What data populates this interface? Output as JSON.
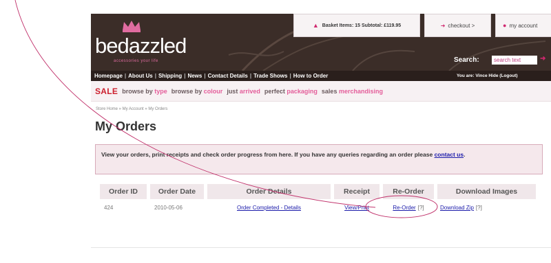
{
  "header": {
    "logo_text": "bedazzled",
    "logo_tagline": "accessories your life",
    "basket": "Basket Items: 15 Subtotal: £119.95",
    "checkout": "checkout >",
    "my_account": "my account",
    "search_label": "Search:",
    "search_value": "search text",
    "user_info": "You are: Vince Hide (Logout)"
  },
  "nav": {
    "items": [
      "Homepage",
      "About Us",
      "Shipping",
      "News",
      "Contact Details",
      "Trade Shows",
      "How to Order"
    ]
  },
  "catbar": {
    "sale": "SALE",
    "browse_type_prefix": "browse by",
    "browse_type_word": "type",
    "browse_colour_prefix": "browse by",
    "browse_colour_word": "colour",
    "arrived_prefix": "just",
    "arrived_word": "arrived",
    "packaging_prefix": "perfect",
    "packaging_word": "packaging",
    "merch_prefix": "sales",
    "merch_word": "merchandising"
  },
  "breadcrumb": "Store Home » My Account » My Orders",
  "page_title": "My Orders",
  "info": {
    "text": "View your orders, print receipts and check order progress from here. If you have any queries regarding an order please",
    "link": "contact us",
    "end": "."
  },
  "table": {
    "headers": [
      "Order ID",
      "Order Date",
      "Order Details",
      "Receipt",
      "Re-Order",
      "Download Images"
    ],
    "row": {
      "order_id": "424",
      "order_date": "2010-05-06",
      "details": "Order Completed - Details",
      "receipt": "View/Print",
      "reorder": "Re-Order",
      "reorder_help": "[?]",
      "download": "Download Zip",
      "download_help": "[?]"
    }
  },
  "colors": {
    "brand_pink": "#d0286f",
    "header_bg": "#3b2d28",
    "annotation": "#c0306a"
  },
  "icons": {
    "crown": "crown-icon",
    "basket": "basket-icon",
    "checkout": "arrow-icon",
    "account": "user-icon"
  }
}
